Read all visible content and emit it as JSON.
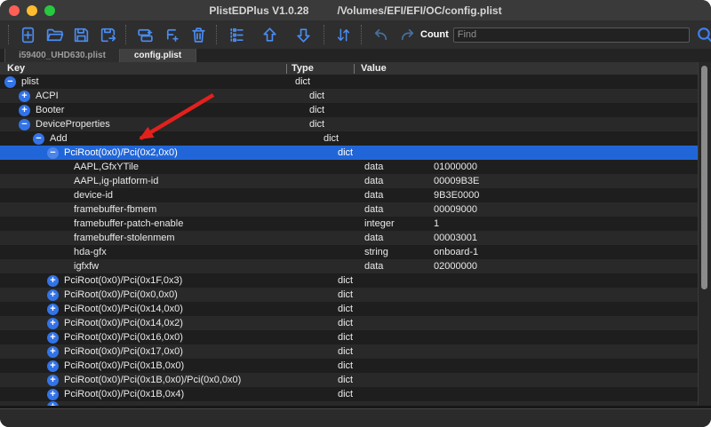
{
  "window": {
    "title": "PlistEDPlus  V1.0.28",
    "path": "/Volumes/EFI/EFI/OC/config.plist"
  },
  "toolbar": {
    "icons": [
      "new-file",
      "open-folder",
      "save",
      "save-as",
      "add-row",
      "add-child-row",
      "trash",
      "tree-view",
      "move-up",
      "move-down",
      "sort",
      "undo",
      "redo",
      "search"
    ],
    "count_label": "Count",
    "find_placeholder": "Find",
    "find_value": ""
  },
  "tabs": [
    {
      "label": "i59400_UHD630.plist",
      "active": false
    },
    {
      "label": "config.plist",
      "active": true
    }
  ],
  "table": {
    "columns": [
      "Key",
      "Type",
      "Value"
    ],
    "rows": [
      {
        "depth": 0,
        "toggle": "minus",
        "key": "plist",
        "type": "dict",
        "value": ""
      },
      {
        "depth": 1,
        "toggle": "plus",
        "key": "ACPI",
        "type": "dict",
        "value": ""
      },
      {
        "depth": 1,
        "toggle": "plus",
        "key": "Booter",
        "type": "dict",
        "value": ""
      },
      {
        "depth": 1,
        "toggle": "minus",
        "key": "DeviceProperties",
        "type": "dict",
        "value": ""
      },
      {
        "depth": 2,
        "toggle": "minus",
        "key": "Add",
        "type": "dict",
        "value": ""
      },
      {
        "depth": 3,
        "toggle": "minus",
        "key": "PciRoot(0x0)/Pci(0x2,0x0)",
        "type": "dict",
        "value": "",
        "selected": true
      },
      {
        "depth": 4,
        "toggle": null,
        "key": "AAPL,GfxYTile",
        "type": "data",
        "value": "01000000"
      },
      {
        "depth": 4,
        "toggle": null,
        "key": "AAPL,ig-platform-id",
        "type": "data",
        "value": "00009B3E"
      },
      {
        "depth": 4,
        "toggle": null,
        "key": "device-id",
        "type": "data",
        "value": "9B3E0000"
      },
      {
        "depth": 4,
        "toggle": null,
        "key": "framebuffer-fbmem",
        "type": "data",
        "value": "00009000"
      },
      {
        "depth": 4,
        "toggle": null,
        "key": "framebuffer-patch-enable",
        "type": "integer",
        "value": "1"
      },
      {
        "depth": 4,
        "toggle": null,
        "key": "framebuffer-stolenmem",
        "type": "data",
        "value": "00003001"
      },
      {
        "depth": 4,
        "toggle": null,
        "key": "hda-gfx",
        "type": "string",
        "value": "onboard-1"
      },
      {
        "depth": 4,
        "toggle": null,
        "key": "igfxfw",
        "type": "data",
        "value": "02000000"
      },
      {
        "depth": 3,
        "toggle": "plus",
        "key": "PciRoot(0x0)/Pci(0x1F,0x3)",
        "type": "dict",
        "value": ""
      },
      {
        "depth": 3,
        "toggle": "plus",
        "key": "PciRoot(0x0)/Pci(0x0,0x0)",
        "type": "dict",
        "value": ""
      },
      {
        "depth": 3,
        "toggle": "plus",
        "key": "PciRoot(0x0)/Pci(0x14,0x0)",
        "type": "dict",
        "value": ""
      },
      {
        "depth": 3,
        "toggle": "plus",
        "key": "PciRoot(0x0)/Pci(0x14,0x2)",
        "type": "dict",
        "value": ""
      },
      {
        "depth": 3,
        "toggle": "plus",
        "key": "PciRoot(0x0)/Pci(0x16,0x0)",
        "type": "dict",
        "value": ""
      },
      {
        "depth": 3,
        "toggle": "plus",
        "key": "PciRoot(0x0)/Pci(0x17,0x0)",
        "type": "dict",
        "value": ""
      },
      {
        "depth": 3,
        "toggle": "plus",
        "key": "PciRoot(0x0)/Pci(0x1B,0x0)",
        "type": "dict",
        "value": ""
      },
      {
        "depth": 3,
        "toggle": "plus",
        "key": "PciRoot(0x0)/Pci(0x1B,0x0)/Pci(0x0,0x0)",
        "type": "dict",
        "value": ""
      },
      {
        "depth": 3,
        "toggle": "plus",
        "key": "PciRoot(0x0)/Pci(0x1B,0x4)",
        "type": "dict",
        "value": ""
      }
    ],
    "partial_row": {
      "depth": 3,
      "toggle": "plus"
    }
  },
  "colors": {
    "accent_blue": "#4a8cf2",
    "selection_blue": "#2166d8",
    "toggle_blue": "#3273e8",
    "arrow_red": "#e3211c",
    "traffic_red": "#ff5f57",
    "traffic_yellow": "#febc2e",
    "traffic_green": "#28c840"
  }
}
